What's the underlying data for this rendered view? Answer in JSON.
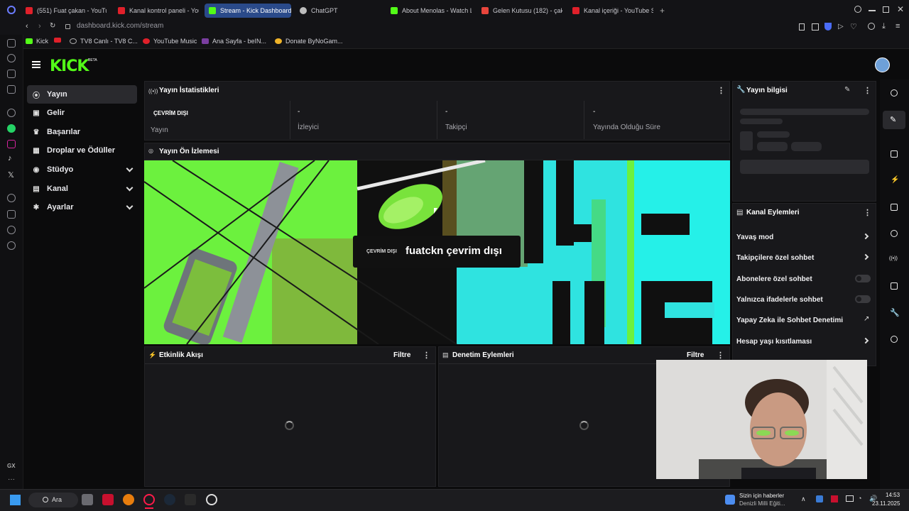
{
  "browser": {
    "tabs": [
      {
        "label": "(551) Fuat çakan - YouTube",
        "icon": "youtube-icon"
      },
      {
        "label": "Kanal kontrol paneli - YouTube",
        "icon": "youtube-icon"
      },
      {
        "label": "Stream - Kick Dashboard",
        "icon": "kick-icon",
        "active": true
      },
      {
        "label": "ChatGPT",
        "icon": "chatgpt-icon"
      },
      {
        "label": "About Menolas - Watch L",
        "icon": "kick-icon"
      },
      {
        "label": "Gelen Kutusu (182) - çakan",
        "icon": "gmail-icon"
      },
      {
        "label": "Kanal içeriği - YouTube St",
        "icon": "youtube-icon"
      }
    ],
    "url": "dashboard.kick.com/stream",
    "bookmarks": [
      "Kick",
      "TV8 Canlı - TV8 C...",
      "YouTube Music",
      "Ana Sayfa - beIN...",
      "Donate ByNoGam..."
    ]
  },
  "header": {
    "logo": "KICK",
    "beta": "BETA"
  },
  "nav": [
    {
      "label": "Yayın",
      "icon": "broadcast-icon",
      "active": true
    },
    {
      "label": "Gelir",
      "icon": "revenue-icon"
    },
    {
      "label": "Başarılar",
      "icon": "trophy-icon"
    },
    {
      "label": "Droplar ve Ödüller",
      "icon": "drops-icon"
    },
    {
      "label": "Stüdyo",
      "icon": "studio-icon",
      "expandable": true
    },
    {
      "label": "Kanal",
      "icon": "channel-icon",
      "expandable": true
    },
    {
      "label": "Ayarlar",
      "icon": "settings-icon",
      "expandable": true
    }
  ],
  "stats": {
    "title": "Yayın İstatistikleri",
    "status": "ÇEVRİM DIŞI",
    "status_label": "Yayın",
    "viewers_value": "-",
    "viewers_label": "İzleyici",
    "followers_value": "-",
    "followers_label": "Takipçi",
    "duration_value": "-",
    "duration_label": "Yayında Olduğu Süre"
  },
  "preview": {
    "title": "Yayın Ön İzlemesi",
    "badge": "ÇEVRİM DIŞI",
    "message": "fuatckn çevrim dışı",
    "art_text": "OFF-LINE"
  },
  "activity": {
    "title": "Etkinlik Akışı",
    "filter": "Filtre"
  },
  "moderation": {
    "title": "Denetim Eylemleri",
    "filter": "Filtre"
  },
  "stream_info": {
    "title": "Yayın bilgisi"
  },
  "channel_actions": {
    "title": "Kanal Eylemleri",
    "items": [
      {
        "label": "Yavaş mod",
        "control": "arrow"
      },
      {
        "label": "Takipçilere özel sohbet",
        "control": "arrow"
      },
      {
        "label": "Abonelere özel sohbet",
        "control": "toggle",
        "on": false
      },
      {
        "label": "Yalnızca ifadelerle sohbet",
        "control": "toggle",
        "on": false
      },
      {
        "label": "Yapay Zeka ile Sohbet Denetimi",
        "control": "external"
      },
      {
        "label": "Hesap yaşı kısıtlaması",
        "control": "arrow"
      }
    ]
  },
  "taskbar": {
    "search": "Ara",
    "news_title": "Sizin için haberler",
    "news_sub": "Denizli Milli Eğiti...",
    "time": "14:53",
    "date": "23.11.2025"
  },
  "colors": {
    "kick_green": "#53fc18",
    "panel": "#18181b",
    "bg": "#0b0b0c"
  }
}
